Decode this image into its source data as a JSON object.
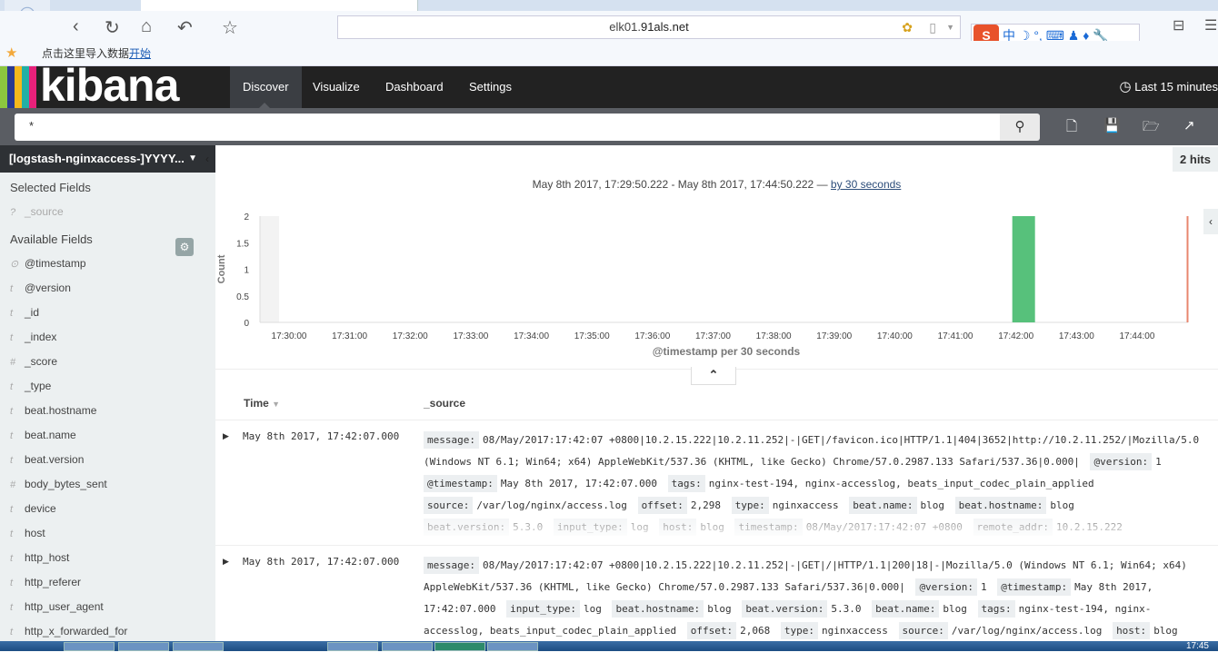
{
  "browser": {
    "url_prefix": "elk01.",
    "url_domain": "91als.net",
    "bookmark_text": "点击这里导入数据",
    "bookmark_link": "开始",
    "ime_label": "中"
  },
  "nav": {
    "logo": "kibana",
    "tabs": [
      {
        "label": "Discover",
        "active": true
      },
      {
        "label": "Visualize"
      },
      {
        "label": "Dashboard"
      },
      {
        "label": "Settings"
      }
    ],
    "time_picker": "Last 15 minutes",
    "stripe_colors": [
      "#8cc63f",
      "#2a3990",
      "#f5b81c",
      "#22b0a5",
      "#e7217a"
    ]
  },
  "search": {
    "query": "*"
  },
  "sidebar": {
    "index_pattern": "[logstash-nginxaccess-]YYYY...",
    "selected_title": "Selected Fields",
    "selected_fields": [
      {
        "type": "?",
        "name": "_source"
      }
    ],
    "available_title": "Available Fields",
    "fields": [
      {
        "type": "⊙",
        "name": "@timestamp"
      },
      {
        "type": "t",
        "name": "@version"
      },
      {
        "type": "t",
        "name": "_id"
      },
      {
        "type": "t",
        "name": "_index"
      },
      {
        "type": "#",
        "name": "_score"
      },
      {
        "type": "t",
        "name": "_type"
      },
      {
        "type": "t",
        "name": "beat.hostname"
      },
      {
        "type": "t",
        "name": "beat.name"
      },
      {
        "type": "t",
        "name": "beat.version"
      },
      {
        "type": "#",
        "name": "body_bytes_sent"
      },
      {
        "type": "t",
        "name": "device"
      },
      {
        "type": "t",
        "name": "host"
      },
      {
        "type": "t",
        "name": "http_host"
      },
      {
        "type": "t",
        "name": "http_referer"
      },
      {
        "type": "t",
        "name": "http_user_agent"
      },
      {
        "type": "t",
        "name": "http_x_forwarded_for"
      }
    ]
  },
  "main": {
    "hits": "2 hits",
    "range_text": "May 8th 2017, 17:29:50.222 - May 8th 2017, 17:44:50.222 —",
    "interval_link": "by 30 seconds",
    "col_time": "Time",
    "col_source": "_source"
  },
  "chart_data": {
    "type": "bar",
    "ylabel": "Count",
    "xlabel": "@timestamp per 30 seconds",
    "ylim": [
      0,
      2
    ],
    "yticks": [
      "0",
      "0.5",
      "1",
      "1.5",
      "2"
    ],
    "xticks": [
      "17:30:00",
      "17:31:00",
      "17:32:00",
      "17:33:00",
      "17:34:00",
      "17:35:00",
      "17:36:00",
      "17:37:00",
      "17:38:00",
      "17:39:00",
      "17:40:00",
      "17:41:00",
      "17:42:00",
      "17:43:00",
      "17:44:00"
    ],
    "bars": [
      {
        "x": "17:42:00",
        "value": 2
      }
    ],
    "bar_color": "#57c17b",
    "now_line": "17:44:50",
    "now_color": "#e8866e"
  },
  "docs": [
    {
      "time": "May 8th 2017, 17:42:07.000",
      "fields": [
        {
          "k": "message:",
          "v": "08/May/2017:17:42:07 +0800|10.2.15.222|10.2.11.252|-|GET|/favicon.ico|HTTP/1.1|404|3652|http://10.2.11.252/|Mozilla/5.0 (Windows NT 6.1; Win64; x64) AppleWebKit/537.36 (KHTML, like Gecko) Chrome/57.0.2987.133 Safari/537.36|0.000|"
        },
        {
          "k": "@version:",
          "v": "1"
        },
        {
          "k": "@timestamp:",
          "v": "May 8th 2017, 17:42:07.000"
        },
        {
          "k": "tags:",
          "v": "nginx-test-194, nginx-accesslog, beats_input_codec_plain_applied"
        },
        {
          "k": "source:",
          "v": "/var/log/nginx/access.log"
        },
        {
          "k": "offset:",
          "v": "2,298"
        },
        {
          "k": "type:",
          "v": "nginxaccess"
        },
        {
          "k": "beat.name:",
          "v": "blog"
        },
        {
          "k": "beat.hostname:",
          "v": "blog"
        },
        {
          "k": "beat.version:",
          "v": "5.3.0"
        },
        {
          "k": "input_type:",
          "v": "log"
        },
        {
          "k": "host:",
          "v": "blog"
        },
        {
          "k": "timestamp:",
          "v": "08/May/2017:17:42:07 +0800"
        },
        {
          "k": "remote_addr:",
          "v": "10.2.15.222"
        }
      ]
    },
    {
      "time": "May 8th 2017, 17:42:07.000",
      "fields": [
        {
          "k": "message:",
          "v": "08/May/2017:17:42:07 +0800|10.2.15.222|10.2.11.252|-|GET|/|HTTP/1.1|200|18|-|Mozilla/5.0 (Windows NT 6.1; Win64; x64) AppleWebKit/537.36 (KHTML, like Gecko) Chrome/57.0.2987.133 Safari/537.36|0.000|"
        },
        {
          "k": "@version:",
          "v": "1"
        },
        {
          "k": "@timestamp:",
          "v": "May 8th 2017, 17:42:07.000"
        },
        {
          "k": "input_type:",
          "v": "log"
        },
        {
          "k": "beat.hostname:",
          "v": "blog"
        },
        {
          "k": "beat.version:",
          "v": "5.3.0"
        },
        {
          "k": "beat.name:",
          "v": "blog"
        },
        {
          "k": "tags:",
          "v": "nginx-test-194, nginx-accesslog, beats_input_codec_plain_applied"
        },
        {
          "k": "offset:",
          "v": "2,068"
        },
        {
          "k": "type:",
          "v": "nginxaccess"
        },
        {
          "k": "source:",
          "v": "/var/log/nginx/access.log"
        },
        {
          "k": "host:",
          "v": "blog"
        }
      ]
    }
  ],
  "taskbar": {
    "clock": "17:45"
  }
}
